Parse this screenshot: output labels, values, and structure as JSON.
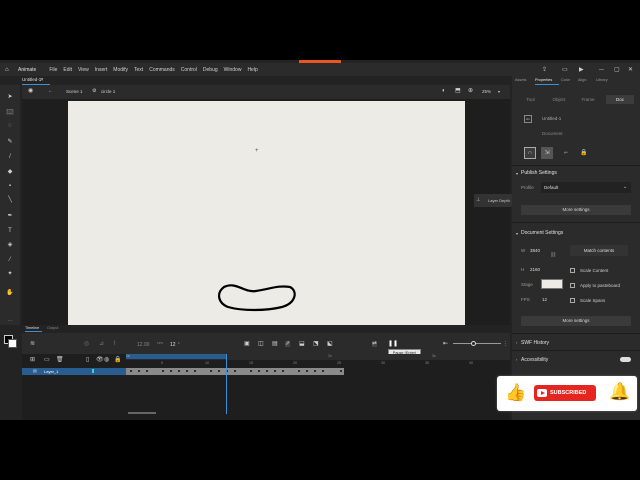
{
  "app": {
    "name": "Animate",
    "menu": [
      "File",
      "Edit",
      "View",
      "Insert",
      "Modify",
      "Text",
      "Commands",
      "Control",
      "Debug",
      "Window",
      "Help"
    ],
    "document_tab": "Untitled-1*"
  },
  "scenebar": {
    "scene": "Scene 1",
    "symbol": "circle 1",
    "zoom": "25%"
  },
  "panel": {
    "tabs": [
      "Assets",
      "Properties",
      "Color",
      "Align",
      "Library"
    ],
    "active_tab": "Properties",
    "subtabs": [
      "Tool",
      "Object",
      "Frame",
      "Doc"
    ],
    "active_subtab": "Doc",
    "doc_name": "Untitled-1",
    "doc_label": "Document",
    "layer_depth": "Layer Depth",
    "publish": {
      "title": "Publish Settings",
      "profile_label": "Profile",
      "profile_value": "Default",
      "more": "More settings"
    },
    "document_settings": {
      "title": "Document Settings",
      "w_label": "W",
      "w_value": "3840",
      "h_label": "H",
      "h_value": "2160",
      "match": "Match contents",
      "scale_content": "Scale Content",
      "stage_label": "Stage",
      "apply_pasteboard": "Apply to pasteboard",
      "fps_label": "FPS",
      "fps_value": "12",
      "scale_spans": "Scale Spans",
      "more": "More settings"
    },
    "swf_history": "SWF History",
    "accessibility": "Accessibility"
  },
  "timeline": {
    "tabs": [
      "Timeline",
      "Output"
    ],
    "fps_display": "12.00",
    "fps_unit": "FPS",
    "frame_display": "12",
    "frame_unit": "F",
    "tooltip": "Pause (Enter)",
    "layer_name": "Layer_1",
    "ruler": [
      "1s",
      "2s",
      "3s",
      "5",
      "10",
      "15",
      "20",
      "25",
      "30",
      "35",
      "40"
    ]
  },
  "subscribe": {
    "label": "SUBSCRIBED"
  },
  "colors": {
    "accent": "#e8571f",
    "selection": "#3d8fd6",
    "subscribe_red": "#e52620"
  }
}
